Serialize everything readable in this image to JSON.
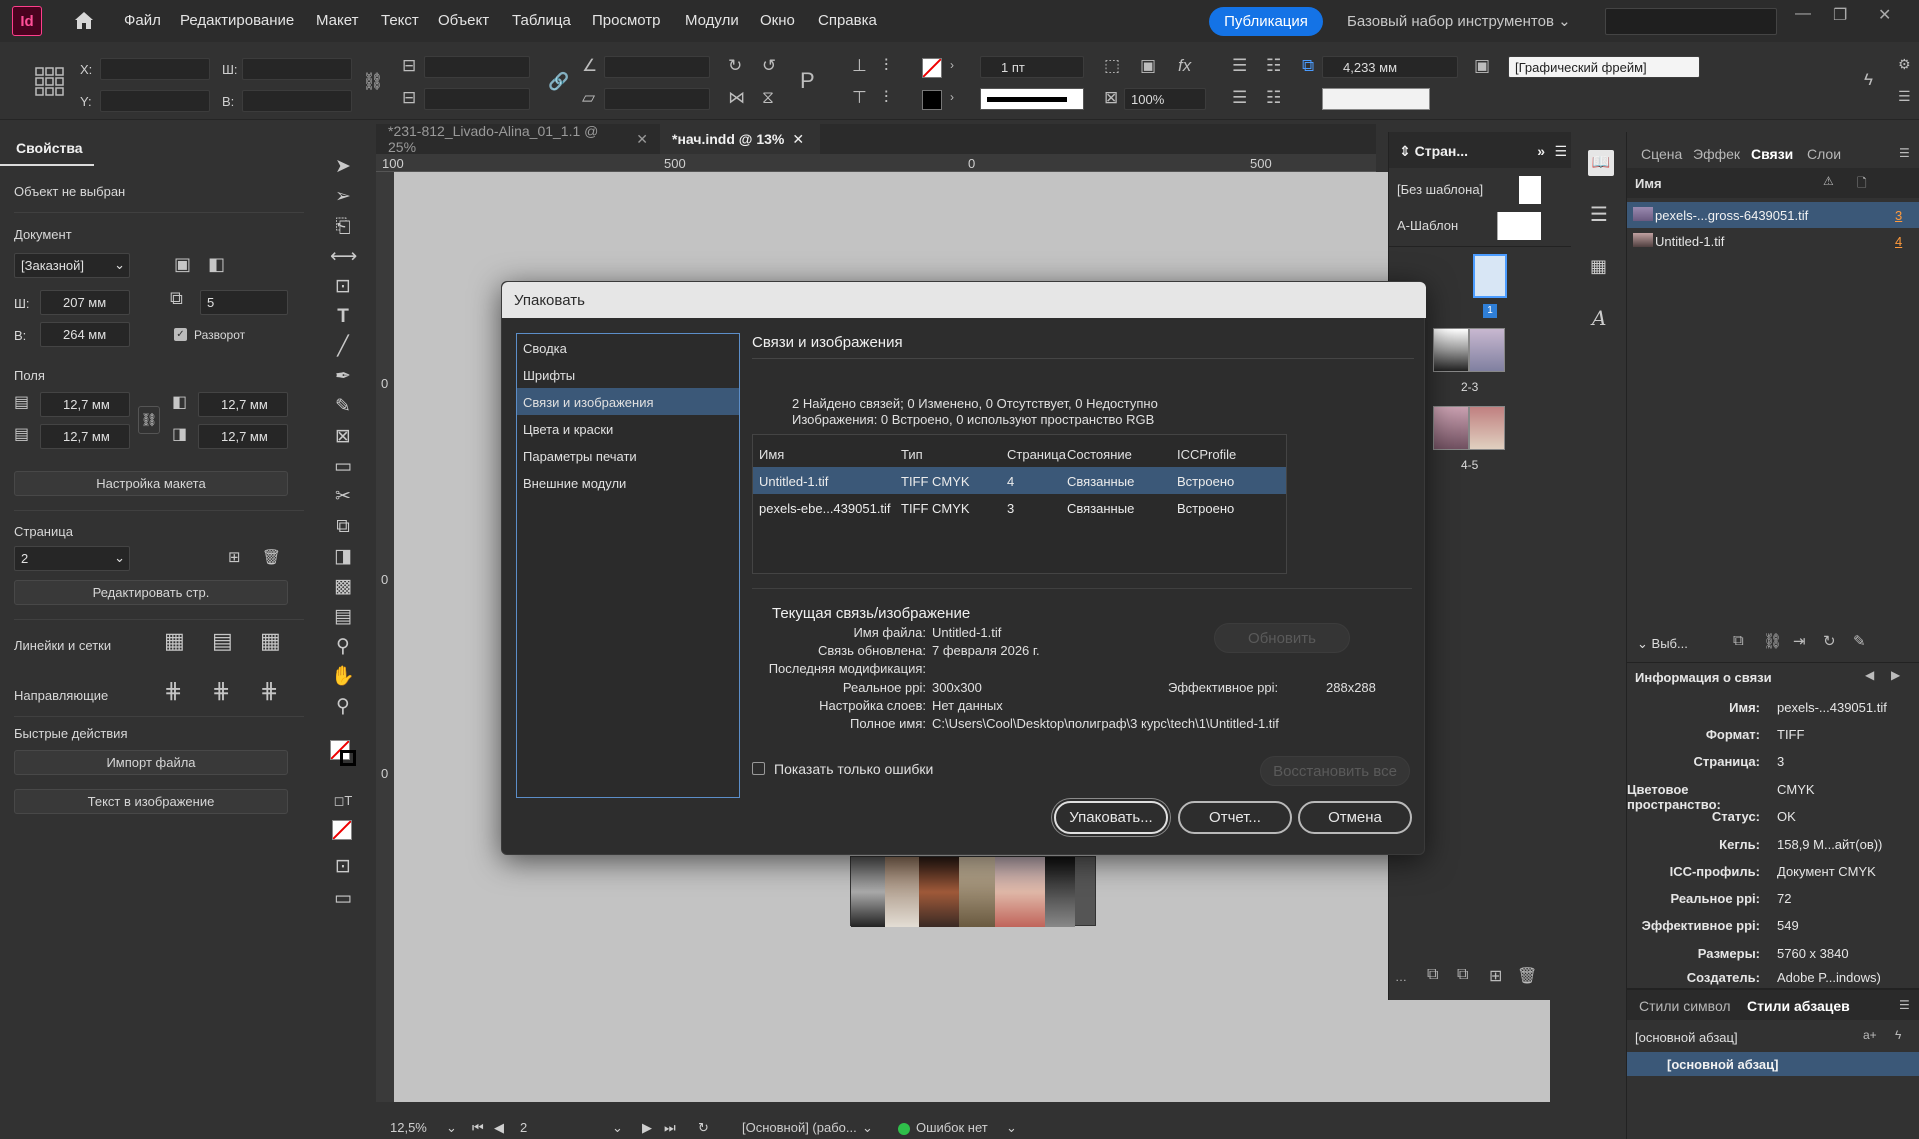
{
  "app": {
    "logo": "Id",
    "menu": [
      "Файл",
      "Редактирование",
      "Макет",
      "Текст",
      "Объект",
      "Таблица",
      "Просмотр",
      "Модули",
      "Окно",
      "Справка"
    ],
    "publish_label": "Публикация",
    "workspace_label": "Базовый набор инструментов"
  },
  "control_panel": {
    "x_label": "X:",
    "y_label": "Y:",
    "w_label": "Ш:",
    "h_label": "В:",
    "stroke_weight": "1 пт",
    "opacity": "100%",
    "spacing_value": "4,233 мм",
    "frame_type": "[Графический фрейм]"
  },
  "properties_panel": {
    "tab_label": "Свойства",
    "no_selection": "Объект не выбран",
    "document_label": "Документ",
    "preset": "[Заказной]",
    "width_label": "Ш:",
    "width_value": "207 мм",
    "height_label": "В:",
    "height_value": "264 мм",
    "pages_count": "5",
    "spread_label": "Разворот",
    "margins_label": "Поля",
    "margin_top": "12,7 мм",
    "margin_bottom": "12,7 мм",
    "margin_left": "12,7 мм",
    "margin_right": "12,7 мм",
    "layout_settings_button": "Настройка макета",
    "page_label": "Страница",
    "page_value": "2",
    "edit_page_button": "Редактировать стр.",
    "rulers_label": "Линейки и сетки",
    "guides_label": "Направляющие",
    "quick_actions_label": "Быстрые действия",
    "import_file_button": "Импорт файла",
    "text_in_image_button": "Текст в изображение"
  },
  "document": {
    "tabs": [
      {
        "label": "*231-812_Livado-Alina_01_1.1 @ 25%",
        "active": false
      },
      {
        "label": "*нач.indd @ 13%",
        "active": true
      }
    ],
    "ruler_h_labels": [
      "100",
      "500",
      "0",
      "500"
    ],
    "ruler_v_labels": [
      "0",
      "0",
      "0"
    ],
    "status": {
      "zoom": "12,5%",
      "page": "2",
      "style": "[Основной] (рабо...",
      "errors": "Ошибок нет"
    }
  },
  "pages_panel": {
    "tab_label": "Стран...",
    "no_master": "[Без шаблона]",
    "a_master": "А-Шаблон",
    "page_1": "1",
    "spread_2_3": "2-3",
    "spread_4_5": "4-5"
  },
  "links_panel": {
    "tabs": [
      "Сцена",
      "Эффек",
      "Связи",
      "Слои"
    ],
    "active_tab": "Связи",
    "name_col": "Имя",
    "links": [
      {
        "name": "pexels-...gross-6439051.tif",
        "page": "3",
        "selected": true
      },
      {
        "name": "Untitled-1.tif",
        "page": "4",
        "selected": false
      }
    ],
    "show_label": "Выб...",
    "link_info_title": "Информация о связи",
    "info": [
      {
        "k": "Имя:",
        "v": "pexels-...439051.tif"
      },
      {
        "k": "Формат:",
        "v": "TIFF"
      },
      {
        "k": "Страница:",
        "v": "3"
      },
      {
        "k": "Цветовое пространство:",
        "v": "CMYK"
      },
      {
        "k": "Статус:",
        "v": "OK"
      },
      {
        "k": "Кегль:",
        "v": "158,9 М...айт(ов))"
      },
      {
        "k": "ICC-профиль:",
        "v": "Документ CMYK"
      },
      {
        "k": "Реальное ppi:",
        "v": "72"
      },
      {
        "k": "Эффективное ppi:",
        "v": "549"
      },
      {
        "k": "Размеры:",
        "v": "5760 x 3840"
      },
      {
        "k": "Создатель:",
        "v": "Adobe P...indows)"
      }
    ]
  },
  "styles_panel": {
    "char_tab": "Стили символ",
    "para_tab": "Стили абзацев",
    "current": "[основной абзац]",
    "selected_style": "[основной абзац]"
  },
  "dialog": {
    "title": "Упаковать",
    "sections": [
      "Сводка",
      "Шрифты",
      "Связи и изображения",
      "Цвета и краски",
      "Параметры печати",
      "Внешние модули"
    ],
    "selected_section": 2,
    "heading": "Связи и изображения",
    "summary_line1": "2 Найдено связей; 0 Изменено, 0 Отсутствует, 0 Недоступно",
    "summary_line2": "Изображения: 0 Встроено, 0 используют пространство RGB",
    "table_headers": {
      "name": "Имя",
      "type": "Тип",
      "page": "Страница",
      "state": "Состояние",
      "icc": "ICCProfile"
    },
    "rows": [
      {
        "name": "Untitled-1.tif",
        "type": "TIFF CMYK",
        "page": "4",
        "state": "Связанные",
        "icc": "Встроено",
        "selected": true
      },
      {
        "name": "pexels-ebe...439051.tif",
        "type": "TIFF CMYK",
        "page": "3",
        "state": "Связанные",
        "icc": "Встроено",
        "selected": false
      }
    ],
    "current_heading": "Текущая связь/изображение",
    "file_name_label": "Имя файла:",
    "file_name": "Untitled-1.tif",
    "updated_label": "Связь обновлена:",
    "updated": "7 февраля 2026 г.",
    "last_mod_label": "Последняя модификация:",
    "real_ppi_label": "Реальное ppi:",
    "real_ppi": "300x300",
    "eff_ppi_label": "Эффективное ppi:",
    "eff_ppi": "288x288",
    "layers_label": "Настройка слоев:",
    "layers": "Нет данных",
    "full_name_label": "Полное имя:",
    "full_name": "C:\\Users\\Cool\\Desktop\\полиграф\\3 курс\\tech\\1\\Untitled-1.tif",
    "update_button": "Обновить",
    "only_errors_label": "Показать только ошибки",
    "restore_all_button": "Восстановить все",
    "package_button": "Упаковать...",
    "report_button": "Отчет...",
    "cancel_button": "Отмена"
  },
  "colors": {
    "accent": "#1473e6",
    "selection": "#3b5878",
    "logo_bg": "#49021f",
    "logo_fg": "#ff4f98"
  }
}
